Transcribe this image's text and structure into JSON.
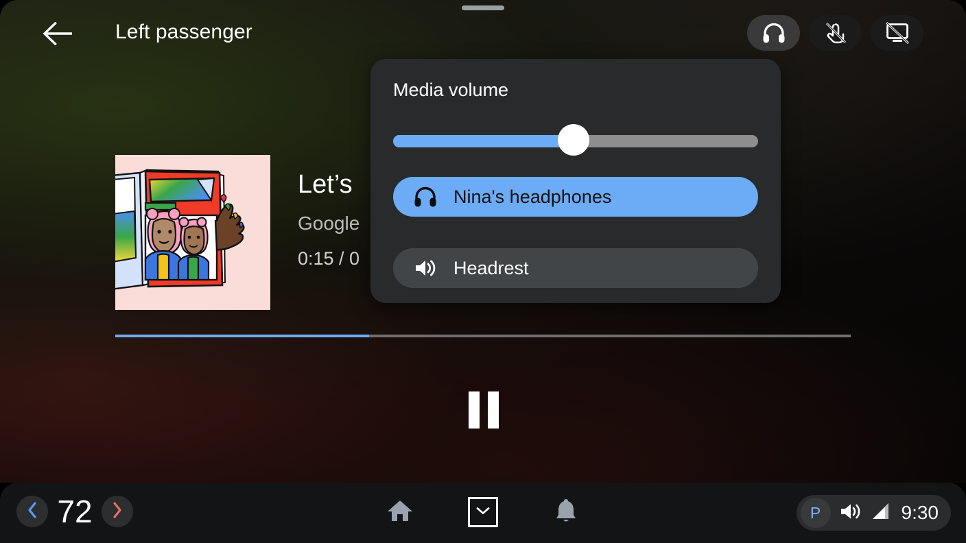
{
  "window": {
    "drag_handle": "drag-handle"
  },
  "topbar": {
    "back_icon": "arrow-left-icon",
    "title": "Left passenger",
    "actions": [
      {
        "name": "headphones-toggle",
        "icon": "headphones-icon",
        "active": true
      },
      {
        "name": "touch-disabled-toggle",
        "icon": "touch-off-icon",
        "active": false
      },
      {
        "name": "screen-off-toggle",
        "icon": "screen-off-icon",
        "active": false
      }
    ]
  },
  "media": {
    "album_art_alt": "album-art-illustration",
    "title": "Let’s",
    "artist": "Google",
    "time": "0:15 / 0",
    "progress_percent": 34.5,
    "transport": {
      "state": "playing",
      "button_icon": "pause-icon"
    }
  },
  "volume_popup": {
    "title": "Media volume",
    "slider": {
      "name": "media-volume-slider",
      "value_percent": 50
    },
    "outputs": [
      {
        "label": "Nina's headphones",
        "icon": "headphones-icon",
        "selected": true
      },
      {
        "label": "Headrest",
        "icon": "speaker-icon",
        "selected": false
      }
    ]
  },
  "statusbar": {
    "temperature": {
      "decrease_icon": "chevron-left-icon",
      "value": "72",
      "increase_icon": "chevron-right-icon"
    },
    "nav": [
      {
        "name": "home",
        "icon": "home-icon"
      },
      {
        "name": "app-drawer",
        "icon": "chevron-down-icon"
      },
      {
        "name": "notifications",
        "icon": "bell-icon"
      }
    ],
    "system": {
      "gear_state": "P",
      "volume_icon": "speaker-icon",
      "signal_icon": "signal-bars-icon",
      "clock": "9:30"
    }
  },
  "colors": {
    "accent_blue": "#6cabf5",
    "panel_bg": "#282a2c",
    "statusbar_bg": "#131416",
    "temp_down": "#5b9bf0",
    "temp_up": "#e8705e",
    "park_blue": "#7fb4f2",
    "album_bg": "#fadcd8"
  }
}
